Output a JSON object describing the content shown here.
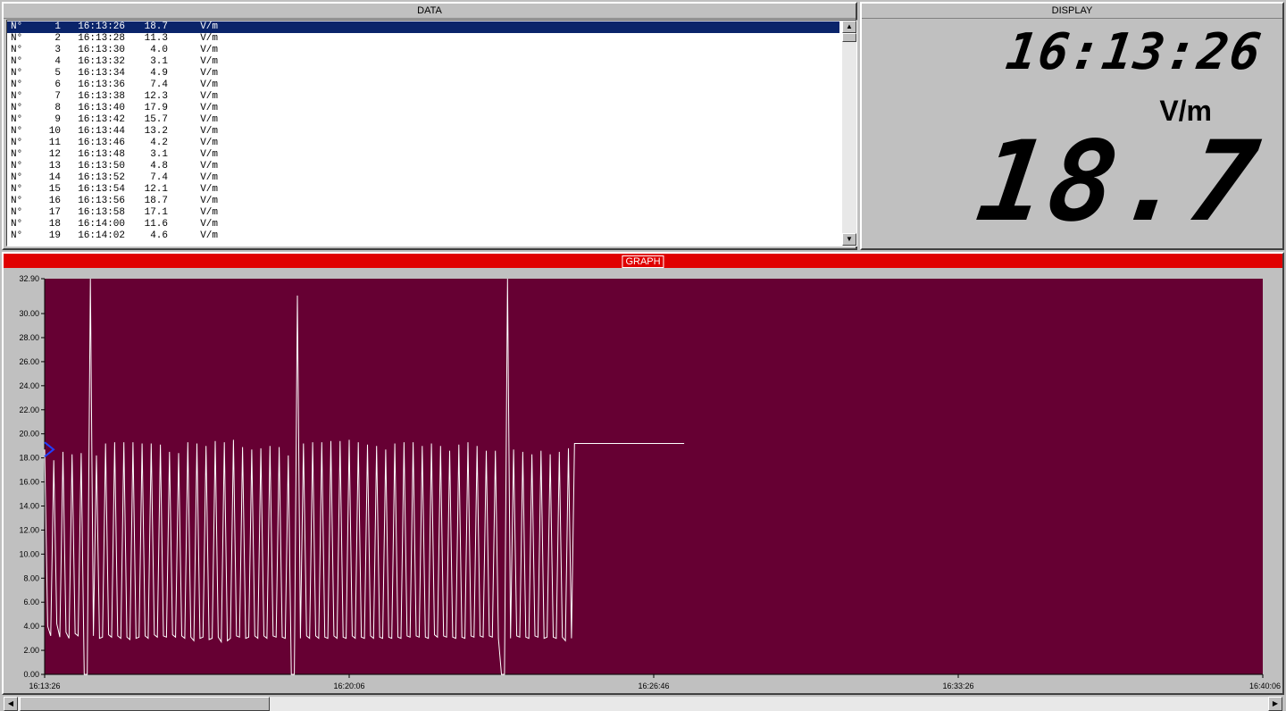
{
  "data_panel": {
    "title": "DATA",
    "rows": [
      {
        "n": "N°",
        "idx": "1",
        "time": "16:13:26",
        "value": "18.7",
        "unit": "V/m"
      },
      {
        "n": "N°",
        "idx": "2",
        "time": "16:13:28",
        "value": "11.3",
        "unit": "V/m"
      },
      {
        "n": "N°",
        "idx": "3",
        "time": "16:13:30",
        "value": "4.0",
        "unit": "V/m"
      },
      {
        "n": "N°",
        "idx": "4",
        "time": "16:13:32",
        "value": "3.1",
        "unit": "V/m"
      },
      {
        "n": "N°",
        "idx": "5",
        "time": "16:13:34",
        "value": "4.9",
        "unit": "V/m"
      },
      {
        "n": "N°",
        "idx": "6",
        "time": "16:13:36",
        "value": "7.4",
        "unit": "V/m"
      },
      {
        "n": "N°",
        "idx": "7",
        "time": "16:13:38",
        "value": "12.3",
        "unit": "V/m"
      },
      {
        "n": "N°",
        "idx": "8",
        "time": "16:13:40",
        "value": "17.9",
        "unit": "V/m"
      },
      {
        "n": "N°",
        "idx": "9",
        "time": "16:13:42",
        "value": "15.7",
        "unit": "V/m"
      },
      {
        "n": "N°",
        "idx": "10",
        "time": "16:13:44",
        "value": "13.2",
        "unit": "V/m"
      },
      {
        "n": "N°",
        "idx": "11",
        "time": "16:13:46",
        "value": "4.2",
        "unit": "V/m"
      },
      {
        "n": "N°",
        "idx": "12",
        "time": "16:13:48",
        "value": "3.1",
        "unit": "V/m"
      },
      {
        "n": "N°",
        "idx": "13",
        "time": "16:13:50",
        "value": "4.8",
        "unit": "V/m"
      },
      {
        "n": "N°",
        "idx": "14",
        "time": "16:13:52",
        "value": "7.4",
        "unit": "V/m"
      },
      {
        "n": "N°",
        "idx": "15",
        "time": "16:13:54",
        "value": "12.1",
        "unit": "V/m"
      },
      {
        "n": "N°",
        "idx": "16",
        "time": "16:13:56",
        "value": "18.7",
        "unit": "V/m"
      },
      {
        "n": "N°",
        "idx": "17",
        "time": "16:13:58",
        "value": "17.1",
        "unit": "V/m"
      },
      {
        "n": "N°",
        "idx": "18",
        "time": "16:14:00",
        "value": "11.6",
        "unit": "V/m"
      },
      {
        "n": "N°",
        "idx": "19",
        "time": "16:14:02",
        "value": "4.6",
        "unit": "V/m"
      }
    ]
  },
  "display_panel": {
    "title": "DISPLAY",
    "time": "16:13:26",
    "unit": "V/m",
    "value": "18.7"
  },
  "graph_panel": {
    "title": "GRAPH"
  },
  "colors": {
    "plot_bg": "#660033",
    "trace": "#ffffff",
    "header_red": "#e00000",
    "selection": "#0a246a"
  },
  "chart_data": {
    "type": "line",
    "title": "",
    "xlabel": "",
    "ylabel": "",
    "ylim": [
      0,
      32.9
    ],
    "y_ticks": [
      "0.00",
      "2.00",
      "4.00",
      "6.00",
      "8.00",
      "10.00",
      "12.00",
      "14.00",
      "16.00",
      "18.00",
      "20.00",
      "22.00",
      "24.00",
      "26.00",
      "28.00",
      "30.00",
      "32.90"
    ],
    "y_tick_values": [
      0,
      2,
      4,
      6,
      8,
      10,
      12,
      14,
      16,
      18,
      20,
      22,
      24,
      26,
      28,
      30,
      32.9
    ],
    "x_ticks": [
      "16:13:26",
      "16:20:06",
      "16:26:46",
      "16:33:26",
      "16:40:06"
    ],
    "x_tick_seconds": [
      0,
      400,
      800,
      1200,
      1600
    ],
    "x_range_seconds": [
      0,
      1600
    ],
    "series": [
      {
        "x_seconds": [
          0,
          4,
          8,
          12,
          16,
          20,
          24,
          28,
          32,
          36,
          40,
          44,
          48,
          52,
          56,
          60,
          64,
          68,
          72,
          76,
          80,
          84,
          88,
          92,
          96,
          100,
          104,
          108,
          112,
          116,
          120,
          124,
          128,
          132,
          136,
          140,
          144,
          148,
          152,
          156,
          160,
          164,
          168,
          172,
          176,
          180,
          184,
          188,
          192,
          196,
          200,
          204,
          208,
          212,
          216,
          220,
          224,
          228,
          232,
          236,
          240,
          244,
          248,
          252,
          256,
          260,
          264,
          268,
          272,
          276,
          280,
          284,
          288,
          292,
          296,
          300,
          304,
          308,
          312,
          316,
          320,
          324,
          328,
          332,
          336,
          340,
          344,
          348,
          352,
          356,
          360,
          364,
          368,
          372,
          376,
          380,
          384,
          388,
          392,
          396,
          400,
          404,
          408,
          412,
          416,
          420,
          424,
          428,
          432,
          436,
          440,
          444,
          448,
          452,
          456,
          460,
          464,
          468,
          472,
          476,
          480,
          484,
          488,
          492,
          496,
          500,
          504,
          508,
          512,
          516,
          520,
          524,
          528,
          532,
          536,
          540,
          544,
          548,
          552,
          556,
          560,
          564,
          568,
          572,
          576,
          580,
          584,
          588,
          592,
          596,
          600,
          604,
          608,
          612,
          616,
          620,
          624,
          628,
          632,
          636,
          640,
          644,
          648,
          652,
          656,
          660,
          664,
          668,
          672,
          676,
          680,
          684,
          688,
          692,
          696,
          700,
          704,
          708,
          712,
          716,
          720,
          724,
          728,
          732,
          736,
          740,
          744,
          748,
          752,
          756,
          760,
          764,
          768,
          772,
          776,
          780,
          784,
          788,
          792,
          796,
          800,
          804,
          808,
          812,
          816,
          820,
          824,
          828,
          832,
          836,
          840,
          844,
          848,
          852,
          856,
          860,
          864,
          868,
          872,
          876,
          880,
          884,
          888,
          892,
          896,
          900,
          904,
          908,
          912,
          916,
          920
        ],
        "values": [
          18.7,
          4.0,
          3.2,
          17.8,
          4.2,
          3.1,
          18.5,
          3.5,
          3.0,
          18.3,
          3.4,
          3.2,
          18.4,
          0.0,
          0.0,
          32.9,
          3.2,
          18.2,
          3.0,
          3.1,
          19.2,
          3.3,
          3.1,
          19.3,
          3.2,
          3.0,
          19.3,
          3.1,
          2.9,
          19.3,
          3.0,
          3.1,
          19.2,
          3.2,
          3.0,
          19.2,
          3.3,
          3.1,
          19.1,
          3.2,
          3.1,
          18.5,
          3.3,
          3.1,
          18.4,
          3.2,
          3.0,
          19.3,
          3.1,
          2.8,
          19.2,
          3.0,
          3.1,
          19.0,
          2.9,
          3.0,
          19.4,
          3.1,
          2.7,
          19.3,
          2.8,
          3.0,
          19.5,
          3.2,
          3.1,
          18.9,
          3.0,
          3.1,
          18.7,
          3.2,
          3.0,
          18.8,
          3.2,
          3.0,
          19.0,
          3.2,
          3.1,
          18.9,
          3.1,
          3.0,
          18.2,
          0.0,
          0.0,
          31.5,
          3.0,
          19.2,
          3.2,
          3.0,
          19.3,
          3.2,
          3.0,
          19.3,
          3.1,
          3.0,
          19.4,
          3.2,
          3.0,
          19.4,
          3.1,
          3.0,
          19.5,
          3.2,
          3.0,
          19.3,
          3.1,
          3.0,
          19.1,
          3.2,
          3.0,
          19.0,
          3.1,
          3.0,
          18.7,
          3.1,
          3.0,
          19.2,
          3.1,
          3.0,
          19.3,
          3.2,
          3.1,
          19.3,
          3.2,
          3.1,
          19.0,
          3.1,
          3.0,
          19.2,
          3.3,
          3.1,
          19.0,
          3.2,
          3.1,
          18.6,
          3.1,
          3.0,
          19.1,
          3.1,
          3.0,
          19.3,
          3.2,
          3.1,
          19.0,
          3.2,
          3.1,
          18.6,
          3.2,
          3.1,
          18.6,
          3.0,
          0.0,
          0.0,
          32.9,
          3.0,
          18.7,
          3.2,
          3.1,
          18.5,
          3.1,
          3.0,
          18.3,
          3.2,
          3.1,
          18.6,
          3.0,
          3.1,
          18.3,
          3.1,
          3.0,
          18.5,
          3.1,
          2.8,
          18.8,
          3.0,
          19.2,
          19.2,
          19.2,
          19.2,
          19.2,
          19.2,
          19.2,
          19.2,
          19.2,
          19.2,
          19.2,
          19.2,
          19.2,
          19.2,
          19.2,
          19.2,
          19.2,
          19.2,
          19.2,
          19.2,
          19.2,
          19.2,
          19.2,
          19.2,
          19.2,
          19.2,
          19.2,
          19.2,
          19.2,
          19.2,
          19.2,
          19.2,
          19.2,
          19.2,
          19.2,
          19.2,
          19.2
        ]
      }
    ],
    "grid": false,
    "legend": "none"
  }
}
